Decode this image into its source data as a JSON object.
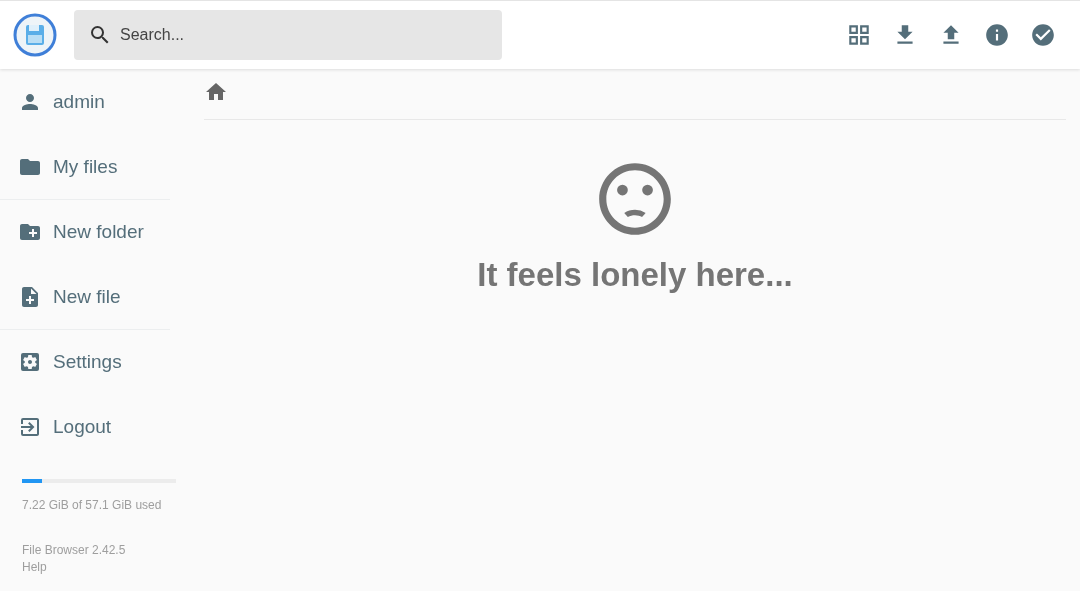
{
  "header": {
    "search": {
      "placeholder": "Search..."
    },
    "actions": [
      {
        "kind": "grid"
      },
      {
        "kind": "download"
      },
      {
        "kind": "upload"
      },
      {
        "kind": "info"
      },
      {
        "kind": "check"
      }
    ]
  },
  "sidebar": {
    "items": [
      {
        "kind": "user",
        "label": "admin",
        "divider_after": false
      },
      {
        "kind": "folder",
        "label": "My files",
        "divider_after": true
      },
      {
        "kind": "new-folder",
        "label": "New folder",
        "divider_after": false
      },
      {
        "kind": "new-file",
        "label": "New file",
        "divider_after": true
      },
      {
        "kind": "settings",
        "label": "Settings",
        "divider_after": false
      },
      {
        "kind": "logout",
        "label": "Logout",
        "divider_after": false
      }
    ],
    "storage": {
      "level": 0.13,
      "text": "7.22 GiB of 57.1 GiB used"
    },
    "footer": {
      "version": "File Browser 2.42.5",
      "help": "Help"
    }
  },
  "main": {
    "empty_message": "It feels lonely here..."
  }
}
